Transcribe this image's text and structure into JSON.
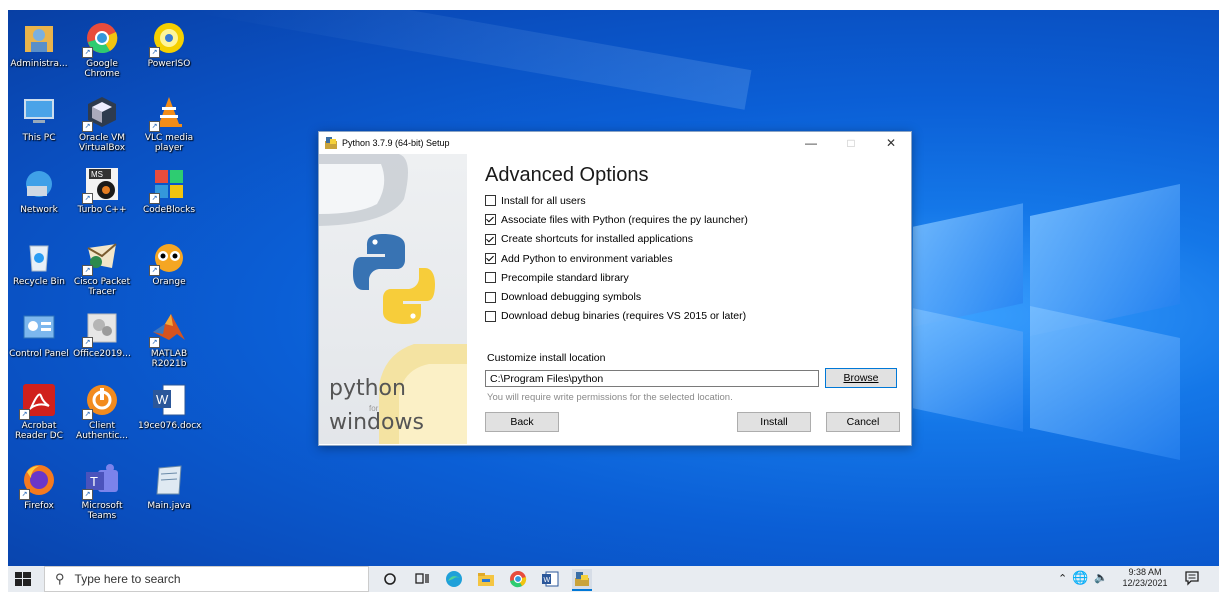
{
  "desktop_icons": [
    {
      "name": "administrator",
      "label": "Administra...",
      "icon": "user-folder-icon",
      "col": 0,
      "row": 0
    },
    {
      "name": "google-chrome",
      "label": "Google Chrome",
      "icon": "chrome-icon",
      "col": 1,
      "row": 0
    },
    {
      "name": "poweriso",
      "label": "PowerISO",
      "icon": "poweriso-disc-icon",
      "col": 2,
      "row": 0
    },
    {
      "name": "this-pc",
      "label": "This PC",
      "icon": "computer-icon",
      "col": 0,
      "row": 1
    },
    {
      "name": "oracle-vm",
      "label": "Oracle VM VirtualBox",
      "icon": "virtualbox-icon",
      "col": 1,
      "row": 1
    },
    {
      "name": "vlc",
      "label": "VLC media player",
      "icon": "vlc-cone-icon",
      "col": 2,
      "row": 1
    },
    {
      "name": "network",
      "label": "Network",
      "icon": "network-icon",
      "col": 0,
      "row": 2
    },
    {
      "name": "turbo-cpp",
      "label": "Turbo C++",
      "icon": "turbo-cpp-icon",
      "col": 1,
      "row": 2
    },
    {
      "name": "codeblocks",
      "label": "CodeBlocks",
      "icon": "codeblocks-icon",
      "col": 2,
      "row": 2
    },
    {
      "name": "recycle-bin",
      "label": "Recycle Bin",
      "icon": "recycle-bin-icon",
      "col": 0,
      "row": 3
    },
    {
      "name": "cisco-packet-tracer",
      "label": "Cisco Packet Tracer",
      "icon": "packet-tracer-icon",
      "col": 1,
      "row": 3
    },
    {
      "name": "orange",
      "label": "Orange",
      "icon": "orange-icon",
      "col": 2,
      "row": 3
    },
    {
      "name": "control-panel",
      "label": "Control Panel",
      "icon": "control-panel-icon",
      "col": 0,
      "row": 4
    },
    {
      "name": "office2019",
      "label": "Office2019...",
      "icon": "office-icon",
      "col": 1,
      "row": 4
    },
    {
      "name": "matlab",
      "label": "MATLAB R2021b",
      "icon": "matlab-icon",
      "col": 2,
      "row": 4
    },
    {
      "name": "acrobat",
      "label": "Acrobat Reader DC",
      "icon": "acrobat-icon",
      "col": 0,
      "row": 5
    },
    {
      "name": "client-authentic",
      "label": "Client Authentic...",
      "icon": "client-auth-icon",
      "col": 1,
      "row": 5
    },
    {
      "name": "word-doc",
      "label": "19ce076.docx",
      "icon": "word-doc-icon",
      "col": 2,
      "row": 5
    },
    {
      "name": "firefox",
      "label": "Firefox",
      "icon": "firefox-icon",
      "col": 0,
      "row": 6
    },
    {
      "name": "microsoft-teams",
      "label": "Microsoft Teams",
      "icon": "teams-icon",
      "col": 1,
      "row": 6
    },
    {
      "name": "main-java",
      "label": "Main.java",
      "icon": "notepad-icon",
      "col": 2,
      "row": 6
    }
  ],
  "setup": {
    "title": "Python 3.7.9 (64-bit) Setup",
    "heading": "Advanced Options",
    "branding_line1": "python",
    "branding_line2": "for",
    "branding_line3": "windows",
    "options": [
      {
        "label": "Install for all users",
        "checked": false
      },
      {
        "label": "Associate files with Python (requires the py launcher)",
        "checked": true
      },
      {
        "label": "Create shortcuts for installed applications",
        "checked": true
      },
      {
        "label": "Add Python to environment variables",
        "checked": true
      },
      {
        "label": "Precompile standard library",
        "checked": false
      },
      {
        "label": "Download debugging symbols",
        "checked": false
      },
      {
        "label": "Download debug binaries (requires VS 2015 or later)",
        "checked": false
      }
    ],
    "location_label": "Customize install location",
    "location_value": "C:\\Program Files\\python",
    "browse_label": "Browse",
    "permission_note": "You will require write permissions for the selected location.",
    "back_label": "Back",
    "install_label": "Install",
    "cancel_label": "Cancel"
  },
  "taskbar": {
    "search_placeholder": "Type here to search",
    "time": "9:38 AM",
    "date": "12/23/2021"
  }
}
